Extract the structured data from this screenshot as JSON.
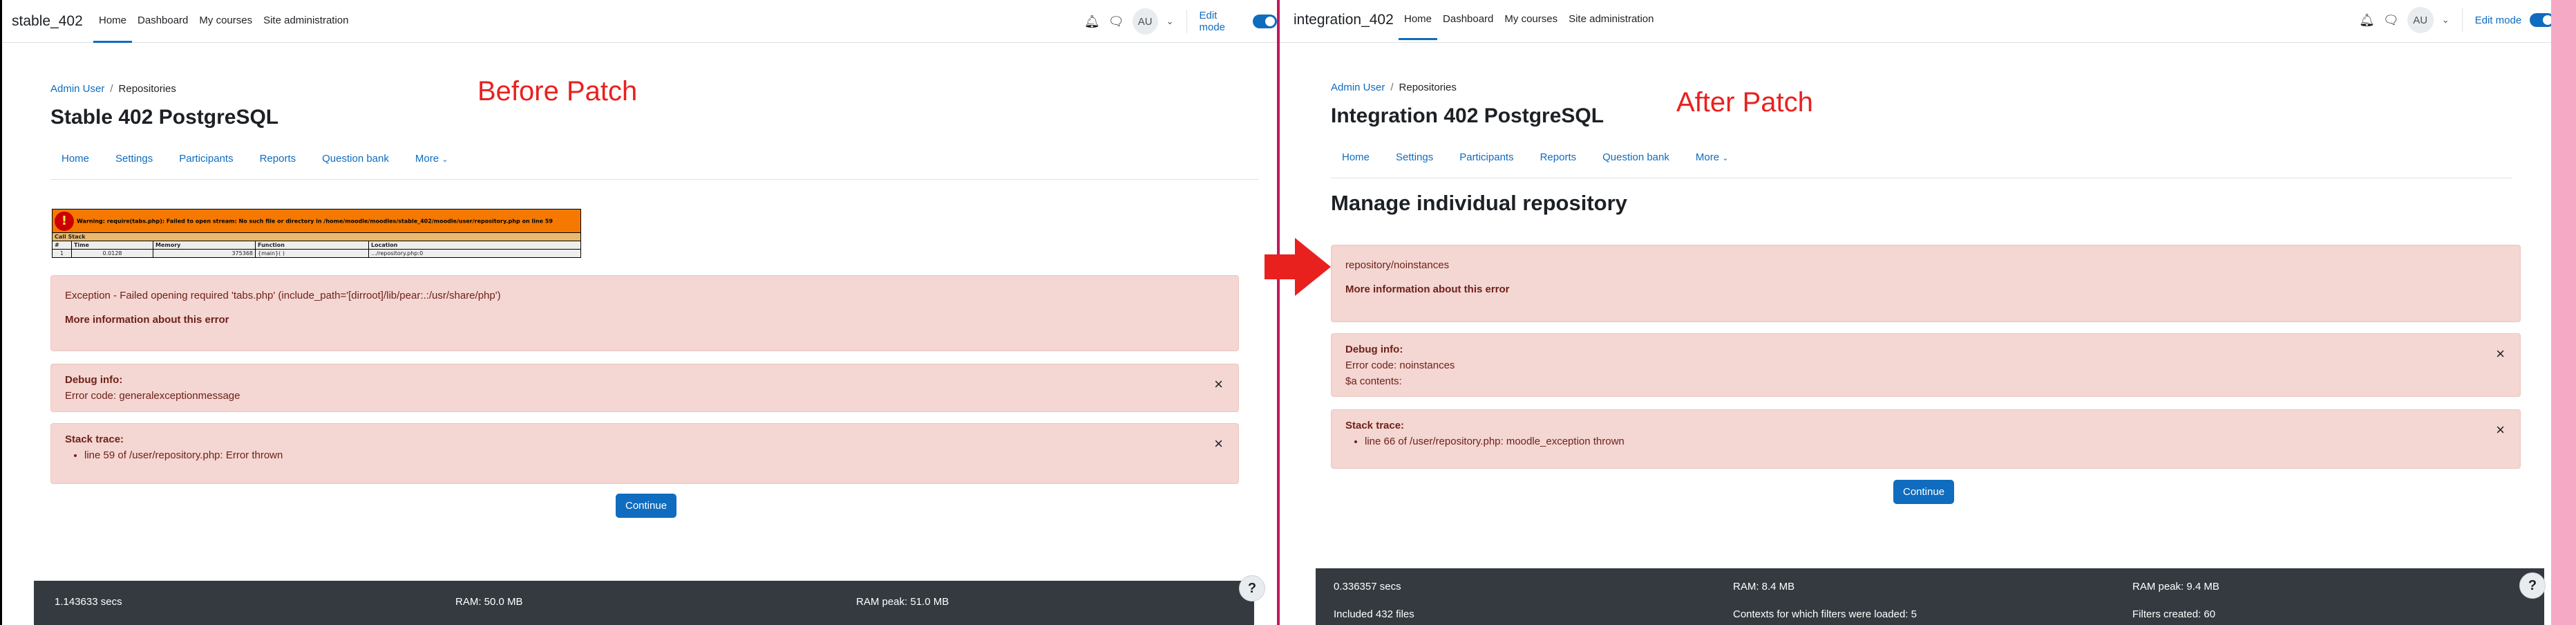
{
  "left": {
    "brand": "stable_402",
    "nav": [
      "Home",
      "Dashboard",
      "My courses",
      "Site administration"
    ],
    "edit_mode_label": "Edit mode",
    "avatar_initials": "AU",
    "breadcrumb": {
      "parent": "Admin User",
      "separator": "/",
      "current": "Repositories"
    },
    "course_title": "Stable 402 PostgreSQL",
    "patch_label": "Before Patch",
    "secondary_nav": [
      "Home",
      "Settings",
      "Participants",
      "Reports",
      "Question bank",
      "More"
    ],
    "warning": {
      "message": "Warning: require(tabs.php): Failed to open stream: No such file or directory in /home/moodle/moodles/stable_402/moodle/user/repository.php on line 59",
      "call_stack_label": "Call Stack",
      "headers": [
        "#",
        "Time",
        "Memory",
        "Function",
        "Location"
      ],
      "row": [
        "1",
        "0.0128",
        "375368",
        "{main}( )",
        ".../repository.php:0"
      ]
    },
    "exception": {
      "message": "Exception - Failed opening required 'tabs.php' (include_path='[dirroot]/lib/pear:.:/usr/share/php')",
      "more_info": "More information about this error"
    },
    "debug": {
      "title": "Debug info:",
      "error_code": "Error code: generalexceptionmessage"
    },
    "stack": {
      "title": "Stack trace:",
      "items": [
        "line 59 of /user/repository.php: Error thrown"
      ]
    },
    "continue_label": "Continue",
    "footer": {
      "secs": "1.143633 secs",
      "ram": "RAM: 50.0 MB",
      "ram_peak": "RAM peak: 51.0 MB"
    },
    "help_label": "?"
  },
  "right": {
    "brand": "integration_402",
    "nav": [
      "Home",
      "Dashboard",
      "My courses",
      "Site administration"
    ],
    "edit_mode_label": "Edit mode",
    "avatar_initials": "AU",
    "breadcrumb": {
      "parent": "Admin User",
      "separator": "/",
      "current": "Repositories"
    },
    "course_title": "Integration 402 PostgreSQL",
    "patch_label": "After Patch",
    "secondary_nav": [
      "Home",
      "Settings",
      "Participants",
      "Reports",
      "Question bank",
      "More"
    ],
    "page_heading": "Manage individual repository",
    "exception": {
      "message": "repository/noinstances",
      "more_info": "More information about this error"
    },
    "debug": {
      "title": "Debug info:",
      "error_code": "Error code: noinstances",
      "a_contents": "$a contents:"
    },
    "stack": {
      "title": "Stack trace:",
      "items": [
        "line 66 of /user/repository.php: moodle_exception thrown"
      ]
    },
    "continue_label": "Continue",
    "footer": {
      "secs": "0.336357 secs",
      "ram": "RAM: 8.4 MB",
      "ram_peak": "RAM peak: 9.4 MB",
      "files": "Included 432 files",
      "contexts": "Contexts for which filters were loaded: 5",
      "filters": "Filters created: 60"
    },
    "help_label": "?"
  },
  "colors": {
    "accent": "#0f6cbf",
    "error_bg": "#f4d6d2",
    "error_text": "#6e211a",
    "patch_label": "#e8211e",
    "footer_bg": "#343a40",
    "arrow": "#e8211e"
  },
  "icons": [
    "bell-icon",
    "chat-icon",
    "close-icon",
    "chevron-down-icon",
    "warning-icon",
    "arrow-right-icon",
    "help-icon"
  ]
}
